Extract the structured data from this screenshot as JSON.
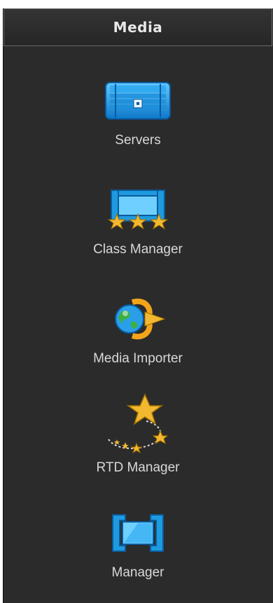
{
  "panel": {
    "title": "Media",
    "items": [
      {
        "label": "Servers",
        "icon": "server-icon"
      },
      {
        "label": "Class Manager",
        "icon": "class-manager-icon"
      },
      {
        "label": "Media Importer",
        "icon": "media-importer-icon"
      },
      {
        "label": "RTD Manager",
        "icon": "rtd-manager-icon"
      },
      {
        "label": "Manager",
        "icon": "manager-icon"
      }
    ]
  },
  "colors": {
    "background": "#2b2b2b",
    "text": "#d8d8d8",
    "icon_blue": "#1e9be0",
    "icon_gold": "#f2b830"
  }
}
